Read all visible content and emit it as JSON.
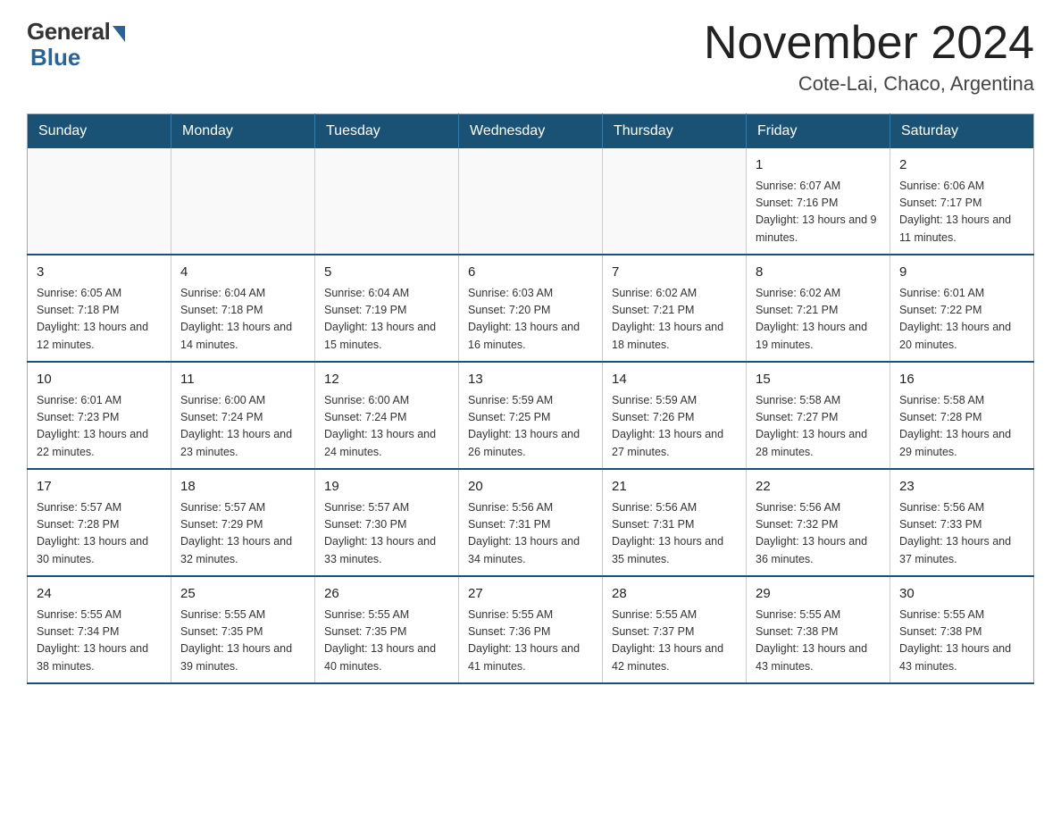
{
  "logo": {
    "general": "General",
    "blue": "Blue"
  },
  "title": "November 2024",
  "subtitle": "Cote-Lai, Chaco, Argentina",
  "weekdays": [
    "Sunday",
    "Monday",
    "Tuesday",
    "Wednesday",
    "Thursday",
    "Friday",
    "Saturday"
  ],
  "weeks": [
    [
      {
        "day": "",
        "info": ""
      },
      {
        "day": "",
        "info": ""
      },
      {
        "day": "",
        "info": ""
      },
      {
        "day": "",
        "info": ""
      },
      {
        "day": "",
        "info": ""
      },
      {
        "day": "1",
        "info": "Sunrise: 6:07 AM\nSunset: 7:16 PM\nDaylight: 13 hours and 9 minutes."
      },
      {
        "day": "2",
        "info": "Sunrise: 6:06 AM\nSunset: 7:17 PM\nDaylight: 13 hours and 11 minutes."
      }
    ],
    [
      {
        "day": "3",
        "info": "Sunrise: 6:05 AM\nSunset: 7:18 PM\nDaylight: 13 hours and 12 minutes."
      },
      {
        "day": "4",
        "info": "Sunrise: 6:04 AM\nSunset: 7:18 PM\nDaylight: 13 hours and 14 minutes."
      },
      {
        "day": "5",
        "info": "Sunrise: 6:04 AM\nSunset: 7:19 PM\nDaylight: 13 hours and 15 minutes."
      },
      {
        "day": "6",
        "info": "Sunrise: 6:03 AM\nSunset: 7:20 PM\nDaylight: 13 hours and 16 minutes."
      },
      {
        "day": "7",
        "info": "Sunrise: 6:02 AM\nSunset: 7:21 PM\nDaylight: 13 hours and 18 minutes."
      },
      {
        "day": "8",
        "info": "Sunrise: 6:02 AM\nSunset: 7:21 PM\nDaylight: 13 hours and 19 minutes."
      },
      {
        "day": "9",
        "info": "Sunrise: 6:01 AM\nSunset: 7:22 PM\nDaylight: 13 hours and 20 minutes."
      }
    ],
    [
      {
        "day": "10",
        "info": "Sunrise: 6:01 AM\nSunset: 7:23 PM\nDaylight: 13 hours and 22 minutes."
      },
      {
        "day": "11",
        "info": "Sunrise: 6:00 AM\nSunset: 7:24 PM\nDaylight: 13 hours and 23 minutes."
      },
      {
        "day": "12",
        "info": "Sunrise: 6:00 AM\nSunset: 7:24 PM\nDaylight: 13 hours and 24 minutes."
      },
      {
        "day": "13",
        "info": "Sunrise: 5:59 AM\nSunset: 7:25 PM\nDaylight: 13 hours and 26 minutes."
      },
      {
        "day": "14",
        "info": "Sunrise: 5:59 AM\nSunset: 7:26 PM\nDaylight: 13 hours and 27 minutes."
      },
      {
        "day": "15",
        "info": "Sunrise: 5:58 AM\nSunset: 7:27 PM\nDaylight: 13 hours and 28 minutes."
      },
      {
        "day": "16",
        "info": "Sunrise: 5:58 AM\nSunset: 7:28 PM\nDaylight: 13 hours and 29 minutes."
      }
    ],
    [
      {
        "day": "17",
        "info": "Sunrise: 5:57 AM\nSunset: 7:28 PM\nDaylight: 13 hours and 30 minutes."
      },
      {
        "day": "18",
        "info": "Sunrise: 5:57 AM\nSunset: 7:29 PM\nDaylight: 13 hours and 32 minutes."
      },
      {
        "day": "19",
        "info": "Sunrise: 5:57 AM\nSunset: 7:30 PM\nDaylight: 13 hours and 33 minutes."
      },
      {
        "day": "20",
        "info": "Sunrise: 5:56 AM\nSunset: 7:31 PM\nDaylight: 13 hours and 34 minutes."
      },
      {
        "day": "21",
        "info": "Sunrise: 5:56 AM\nSunset: 7:31 PM\nDaylight: 13 hours and 35 minutes."
      },
      {
        "day": "22",
        "info": "Sunrise: 5:56 AM\nSunset: 7:32 PM\nDaylight: 13 hours and 36 minutes."
      },
      {
        "day": "23",
        "info": "Sunrise: 5:56 AM\nSunset: 7:33 PM\nDaylight: 13 hours and 37 minutes."
      }
    ],
    [
      {
        "day": "24",
        "info": "Sunrise: 5:55 AM\nSunset: 7:34 PM\nDaylight: 13 hours and 38 minutes."
      },
      {
        "day": "25",
        "info": "Sunrise: 5:55 AM\nSunset: 7:35 PM\nDaylight: 13 hours and 39 minutes."
      },
      {
        "day": "26",
        "info": "Sunrise: 5:55 AM\nSunset: 7:35 PM\nDaylight: 13 hours and 40 minutes."
      },
      {
        "day": "27",
        "info": "Sunrise: 5:55 AM\nSunset: 7:36 PM\nDaylight: 13 hours and 41 minutes."
      },
      {
        "day": "28",
        "info": "Sunrise: 5:55 AM\nSunset: 7:37 PM\nDaylight: 13 hours and 42 minutes."
      },
      {
        "day": "29",
        "info": "Sunrise: 5:55 AM\nSunset: 7:38 PM\nDaylight: 13 hours and 43 minutes."
      },
      {
        "day": "30",
        "info": "Sunrise: 5:55 AM\nSunset: 7:38 PM\nDaylight: 13 hours and 43 minutes."
      }
    ]
  ]
}
